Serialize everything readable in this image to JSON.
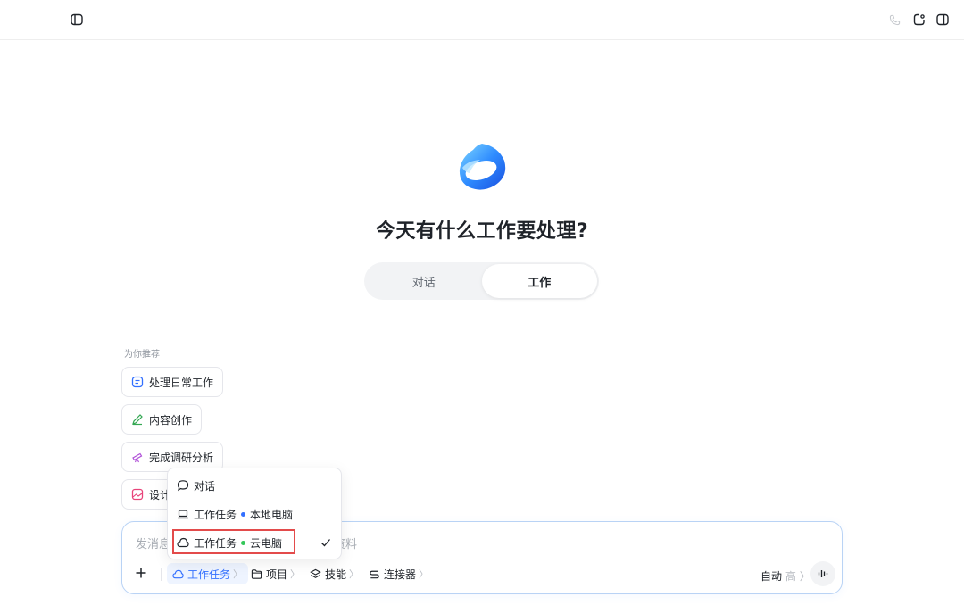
{
  "headline": "今天有什么工作要处理?",
  "mode_tabs": [
    {
      "label": "对话",
      "active": false
    },
    {
      "label": "工作",
      "active": true
    }
  ],
  "recommend": {
    "label": "为你推荐",
    "chips": [
      {
        "label": "处理日常工作",
        "icon": "document-icon",
        "color": "#3370ff"
      },
      {
        "label": "内容创作",
        "icon": "pen-icon",
        "color": "#34a853"
      },
      {
        "label": "完成调研分析",
        "icon": "telescope-icon",
        "color": "#b04fd8"
      },
      {
        "label": "设计",
        "icon": "image-icon",
        "color": "#e8447a"
      }
    ]
  },
  "dropdown": {
    "items": [
      {
        "label": "对话",
        "icon": "chat-bubble-icon"
      },
      {
        "label": "工作任务",
        "sub": "本地电脑",
        "dot_color": "#3370ff",
        "icon": "laptop-icon"
      },
      {
        "label": "工作任务",
        "sub": "云电脑",
        "dot_color": "#34c759",
        "icon": "cloud-icon",
        "selected": true
      }
    ]
  },
  "composer": {
    "placeholder_start": "发消息",
    "placeholder_end": "资料",
    "tools": [
      {
        "label": "工作任务",
        "icon": "cloud-icon",
        "active": true
      },
      {
        "label": "项目",
        "icon": "folder-icon"
      },
      {
        "label": "技能",
        "icon": "layers-icon"
      },
      {
        "label": "连接器",
        "icon": "connector-icon"
      }
    ],
    "chevron": "〉",
    "auto_label": "自动",
    "auto_sub": "高"
  },
  "colors": {
    "accent": "#3370ff",
    "highlight": "#e34b4b"
  }
}
